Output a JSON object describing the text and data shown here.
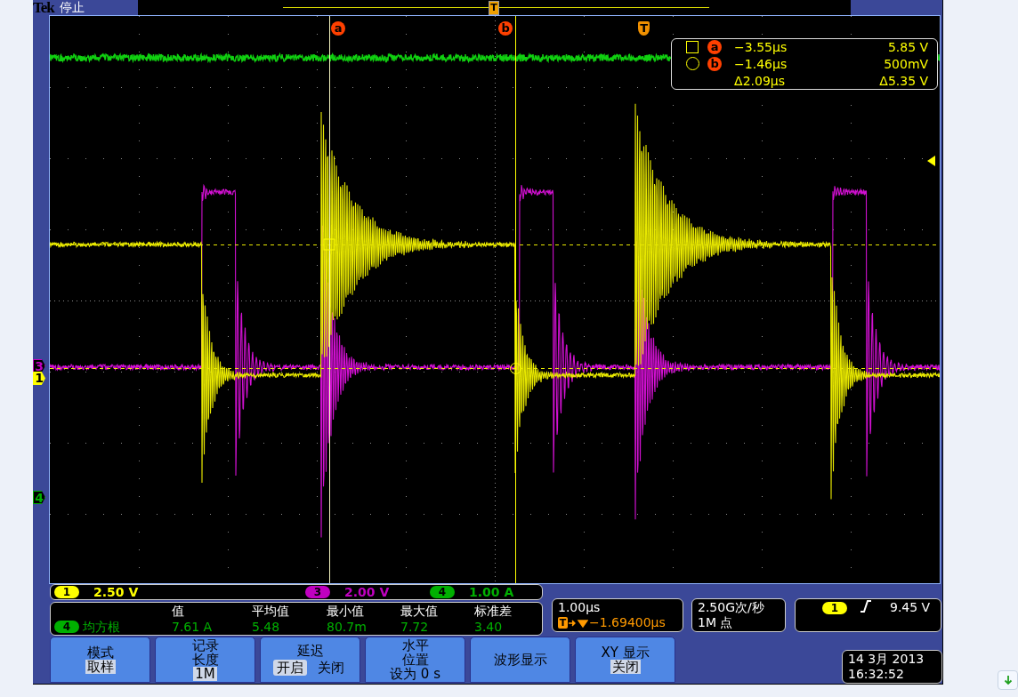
{
  "status": {
    "brand": "Tek",
    "state": "停止",
    "trigger_position_marker": "T"
  },
  "graticule": {
    "cursor_labels": [
      {
        "label": "a",
        "kind": "cursor"
      },
      {
        "label": "b",
        "kind": "cursor"
      },
      {
        "label": "T",
        "kind": "trigger"
      }
    ],
    "channel_markers": [
      {
        "label": "3",
        "color": "#c000c0",
        "kind": "outline"
      },
      {
        "label": "1",
        "color": "#ffff00",
        "kind": "filled"
      },
      {
        "label": "4",
        "color": "#00b000",
        "kind": "outline"
      }
    ]
  },
  "cursor_readout": [
    {
      "kind": "square",
      "label": "a",
      "time": "−3.55µs",
      "value": "5.85 V"
    },
    {
      "kind": "circle",
      "label": "b",
      "time": "−1.46µs",
      "value": "500mV"
    },
    {
      "kind": "delta",
      "time": "Δ2.09µs",
      "value": "Δ5.35 V"
    }
  ],
  "channels": [
    {
      "number": "1",
      "scale": "2.50 V",
      "color": "#ffff00"
    },
    {
      "number": "3",
      "scale": "2.00 V",
      "color": "#c000c0"
    },
    {
      "number": "4",
      "scale": "1.00 A",
      "color": "#00b000"
    }
  ],
  "measurement": {
    "channel": "4",
    "color": "#00b000",
    "name": "均方根",
    "columns": [
      {
        "header": "值",
        "value": "7.61 A"
      },
      {
        "header": "平均值",
        "value": "5.48"
      },
      {
        "header": "最小值",
        "value": "80.7m"
      },
      {
        "header": "最大值",
        "value": "7.72"
      },
      {
        "header": "标准差",
        "value": "3.40"
      }
    ]
  },
  "horizontal": {
    "scale": "1.00µs",
    "marker": "T",
    "position": "−1.69400µs"
  },
  "acquisition": {
    "rate": "2.50G次/秒",
    "length": "1M 点"
  },
  "trigger": {
    "channel": "1",
    "color": "#ffff00",
    "level": "9.45 V"
  },
  "menu_buttons": [
    {
      "kind": "value",
      "title_lines": [
        "模式"
      ],
      "value": "取样"
    },
    {
      "kind": "value",
      "title_lines": [
        "记录",
        "长度"
      ],
      "value": "1M"
    },
    {
      "kind": "toggle",
      "title_lines": [
        "延迟"
      ],
      "options": [
        {
          "label": "开启",
          "selected": true
        },
        {
          "label": "关闭",
          "selected": false
        }
      ]
    },
    {
      "kind": "plain",
      "title_lines": [
        "水平",
        "位置",
        "设为 0 s"
      ]
    },
    {
      "kind": "plain",
      "title_lines": [
        "波形显示"
      ]
    },
    {
      "kind": "value",
      "title_lines": [
        "XY 显示"
      ],
      "value": "关闭"
    }
  ],
  "clock": {
    "date": "14 3月  2013",
    "time": "16:32:52"
  }
}
